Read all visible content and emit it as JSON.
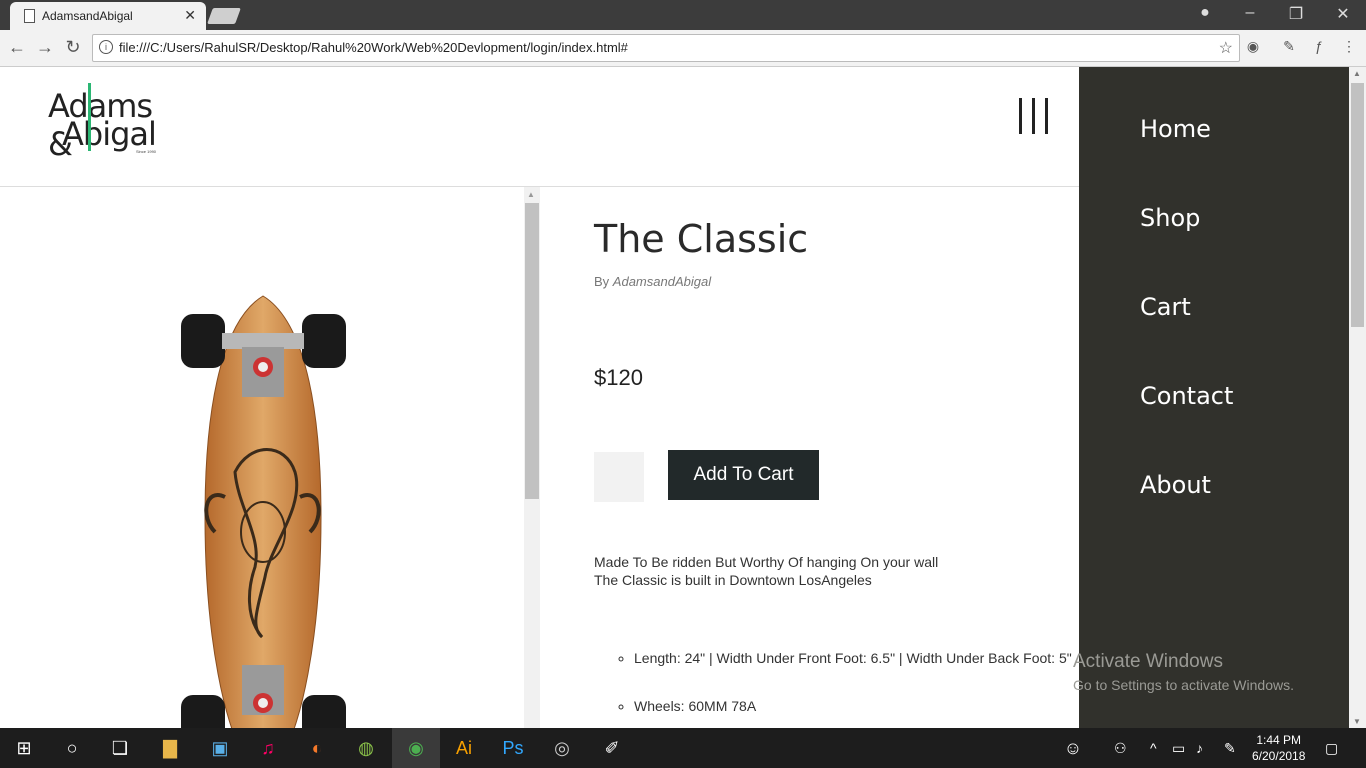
{
  "browser": {
    "tab_title": "AdamsandAbigal",
    "url": "file:///C:/Users/RahulSR/Desktop/Rahul%20Work/Web%20Devlopment/login/index.html#"
  },
  "header": {
    "logo_line1": "Adams &",
    "logo_line2": "Abigal",
    "logo_since": "Since 1990"
  },
  "product": {
    "title": "The Classic",
    "by_prefix": "By ",
    "brand": "AdamsandAbigal",
    "price": "$120",
    "add_to_cart": "Add To Cart",
    "desc_line1": "Made To Be ridden But Worthy Of hanging On your wall",
    "desc_line2": "The Classic is built in Downtown LosAngeles",
    "specs": [
      "Length: 24\" | Width Under Front Foot: 6.5\" | Width Under Back Foot: 5\"",
      "Wheels: 60MM 78A"
    ]
  },
  "sidenav": {
    "items": [
      "Home",
      "Shop",
      "Cart",
      "Contact",
      "About"
    ]
  },
  "watermark": {
    "line1": "Activate Windows",
    "line2": "Go to Settings to activate Windows."
  },
  "taskbar": {
    "time": "1:44 PM",
    "date": "6/20/2018"
  }
}
